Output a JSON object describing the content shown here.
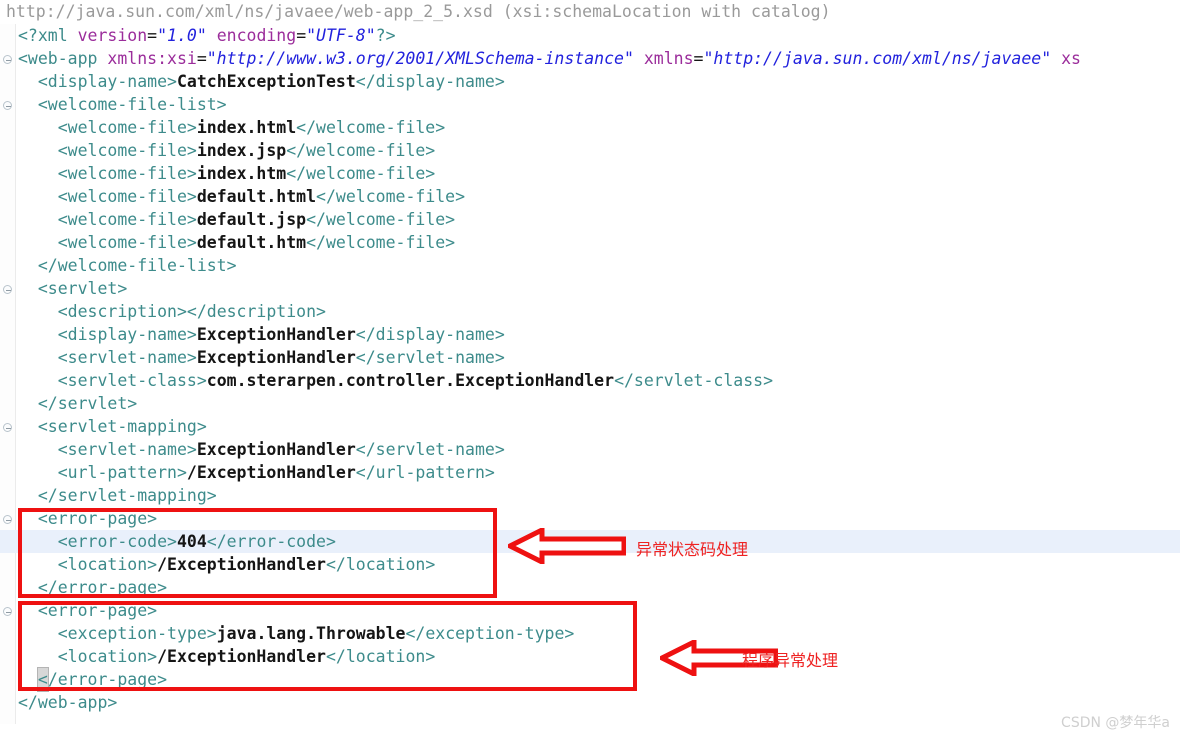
{
  "tooltip": {
    "text": "http://java.sun.com/xml/ns/javaee/web-app_2_5.xsd (xsi:schemaLocation with catalog)"
  },
  "editor": {
    "current_line_index": 22,
    "lines": [
      {
        "fold": false,
        "indent": 0,
        "parts": [
          {
            "c": "pi",
            "t": "<?xml "
          },
          {
            "c": "attr",
            "t": "version"
          },
          {
            "c": "eq",
            "t": "="
          },
          {
            "c": "str",
            "t": "\"1.0\""
          },
          {
            "c": "eq",
            "t": " "
          },
          {
            "c": "attr",
            "t": "encoding"
          },
          {
            "c": "eq",
            "t": "="
          },
          {
            "c": "str",
            "t": "\"UTF-8\""
          },
          {
            "c": "pi",
            "t": "?>"
          }
        ]
      },
      {
        "fold": true,
        "indent": 0,
        "parts": [
          {
            "c": "tag",
            "t": "<web-app "
          },
          {
            "c": "attr",
            "t": "xmlns:xsi"
          },
          {
            "c": "eq",
            "t": "="
          },
          {
            "c": "str",
            "t": "\"http://www.w3.org/2001/XMLSchema-instance\""
          },
          {
            "c": "eq",
            "t": " "
          },
          {
            "c": "attr",
            "t": "xmlns"
          },
          {
            "c": "eq",
            "t": "="
          },
          {
            "c": "str",
            "t": "\"http://java.sun.com/xml/ns/javaee\""
          },
          {
            "c": "eq",
            "t": " "
          },
          {
            "c": "attr",
            "t": "xs"
          }
        ]
      },
      {
        "fold": false,
        "indent": 1,
        "parts": [
          {
            "c": "tag",
            "t": "<display-name>"
          },
          {
            "c": "txt",
            "t": "CatchExceptionTest"
          },
          {
            "c": "tag",
            "t": "</display-name>"
          }
        ]
      },
      {
        "fold": true,
        "indent": 1,
        "parts": [
          {
            "c": "tag",
            "t": "<welcome-file-list>"
          }
        ]
      },
      {
        "fold": false,
        "indent": 2,
        "parts": [
          {
            "c": "tag",
            "t": "<welcome-file>"
          },
          {
            "c": "txt",
            "t": "index.html"
          },
          {
            "c": "tag",
            "t": "</welcome-file>"
          }
        ]
      },
      {
        "fold": false,
        "indent": 2,
        "parts": [
          {
            "c": "tag",
            "t": "<welcome-file>"
          },
          {
            "c": "txt",
            "t": "index.jsp"
          },
          {
            "c": "tag",
            "t": "</welcome-file>"
          }
        ]
      },
      {
        "fold": false,
        "indent": 2,
        "parts": [
          {
            "c": "tag",
            "t": "<welcome-file>"
          },
          {
            "c": "txt",
            "t": "index.htm"
          },
          {
            "c": "tag",
            "t": "</welcome-file>"
          }
        ]
      },
      {
        "fold": false,
        "indent": 2,
        "parts": [
          {
            "c": "tag",
            "t": "<welcome-file>"
          },
          {
            "c": "txt",
            "t": "default.html"
          },
          {
            "c": "tag",
            "t": "</welcome-file>"
          }
        ]
      },
      {
        "fold": false,
        "indent": 2,
        "parts": [
          {
            "c": "tag",
            "t": "<welcome-file>"
          },
          {
            "c": "txt",
            "t": "default.jsp"
          },
          {
            "c": "tag",
            "t": "</welcome-file>"
          }
        ]
      },
      {
        "fold": false,
        "indent": 2,
        "parts": [
          {
            "c": "tag",
            "t": "<welcome-file>"
          },
          {
            "c": "txt",
            "t": "default.htm"
          },
          {
            "c": "tag",
            "t": "</welcome-file>"
          }
        ]
      },
      {
        "fold": false,
        "indent": 1,
        "parts": [
          {
            "c": "tag",
            "t": "</welcome-file-list>"
          }
        ]
      },
      {
        "fold": true,
        "indent": 1,
        "parts": [
          {
            "c": "tag",
            "t": "<servlet>"
          }
        ]
      },
      {
        "fold": false,
        "indent": 2,
        "parts": [
          {
            "c": "tag",
            "t": "<description></description>"
          }
        ]
      },
      {
        "fold": false,
        "indent": 2,
        "parts": [
          {
            "c": "tag",
            "t": "<display-name>"
          },
          {
            "c": "txt",
            "t": "ExceptionHandler"
          },
          {
            "c": "tag",
            "t": "</display-name>"
          }
        ]
      },
      {
        "fold": false,
        "indent": 2,
        "parts": [
          {
            "c": "tag",
            "t": "<servlet-name>"
          },
          {
            "c": "txt",
            "t": "ExceptionHandler"
          },
          {
            "c": "tag",
            "t": "</servlet-name>"
          }
        ]
      },
      {
        "fold": false,
        "indent": 2,
        "parts": [
          {
            "c": "tag",
            "t": "<servlet-class>"
          },
          {
            "c": "txt",
            "t": "com.sterarpen.controller.ExceptionHandler"
          },
          {
            "c": "tag",
            "t": "</servlet-class>"
          }
        ]
      },
      {
        "fold": false,
        "indent": 1,
        "parts": [
          {
            "c": "tag",
            "t": "</servlet>"
          }
        ]
      },
      {
        "fold": true,
        "indent": 1,
        "parts": [
          {
            "c": "tag",
            "t": "<servlet-mapping>"
          }
        ]
      },
      {
        "fold": false,
        "indent": 2,
        "parts": [
          {
            "c": "tag",
            "t": "<servlet-name>"
          },
          {
            "c": "txt",
            "t": "ExceptionHandler"
          },
          {
            "c": "tag",
            "t": "</servlet-name>"
          }
        ]
      },
      {
        "fold": false,
        "indent": 2,
        "parts": [
          {
            "c": "tag",
            "t": "<url-pattern>"
          },
          {
            "c": "txt",
            "t": "/ExceptionHandler"
          },
          {
            "c": "tag",
            "t": "</url-pattern>"
          }
        ]
      },
      {
        "fold": false,
        "indent": 1,
        "parts": [
          {
            "c": "tag",
            "t": "</servlet-mapping>"
          }
        ]
      },
      {
        "fold": true,
        "indent": 1,
        "parts": [
          {
            "c": "tag",
            "t": "<error-page>"
          }
        ]
      },
      {
        "fold": false,
        "indent": 2,
        "parts": [
          {
            "c": "tag",
            "t": "<error-code>"
          },
          {
            "c": "txt",
            "t": "404"
          },
          {
            "c": "tag",
            "t": "</error-code>"
          }
        ]
      },
      {
        "fold": false,
        "indent": 2,
        "parts": [
          {
            "c": "tag",
            "t": "<location>"
          },
          {
            "c": "txt",
            "t": "/ExceptionHandler"
          },
          {
            "c": "tag",
            "t": "</location>"
          }
        ]
      },
      {
        "fold": false,
        "indent": 1,
        "parts": [
          {
            "c": "tag",
            "t": "</error-page>"
          }
        ]
      },
      {
        "fold": true,
        "indent": 1,
        "parts": [
          {
            "c": "tag",
            "t": "<error-page>"
          }
        ]
      },
      {
        "fold": false,
        "indent": 2,
        "parts": [
          {
            "c": "tag",
            "t": "<exception-type>"
          },
          {
            "c": "txt",
            "t": "java.lang.Throwable"
          },
          {
            "c": "tag",
            "t": "</exception-type>"
          }
        ]
      },
      {
        "fold": false,
        "indent": 2,
        "parts": [
          {
            "c": "tag",
            "t": "<location>"
          },
          {
            "c": "txt",
            "t": "/ExceptionHandler"
          },
          {
            "c": "tag",
            "t": "</location>"
          }
        ]
      },
      {
        "fold": false,
        "indent": 1,
        "brace": true,
        "parts": [
          {
            "c": "tag",
            "t": "<"
          },
          {
            "c": "tag",
            "t": "/error-page>"
          }
        ]
      },
      {
        "fold": false,
        "indent": 0,
        "parts": [
          {
            "c": "tag",
            "t": "</web-app>"
          }
        ]
      }
    ]
  },
  "annotations": {
    "box_color": "#ee1111",
    "items": [
      {
        "label": "异常状态码处理"
      },
      {
        "label": "程序异常处理"
      }
    ]
  },
  "watermark": {
    "text": "CSDN @梦年华a"
  }
}
